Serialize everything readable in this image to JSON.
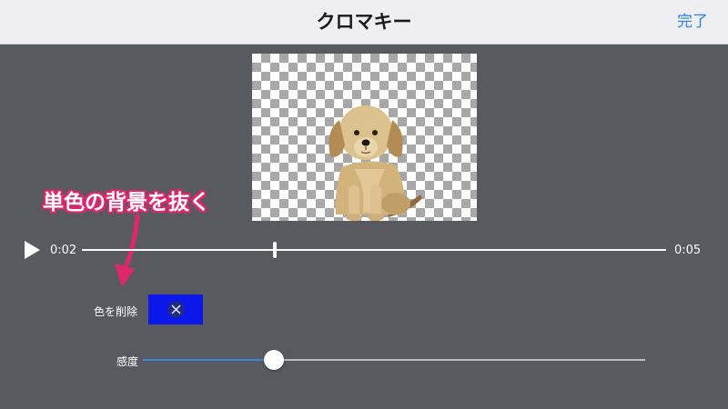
{
  "nav": {
    "title": "クロマキー",
    "done_label": "完了"
  },
  "preview": {
    "subject_icon": "dog-cutout-icon"
  },
  "annotation": {
    "callout_text": "単色の背景を抜く",
    "accent_color": "#e0266d"
  },
  "playback": {
    "current_time": "0:02",
    "total_time": "0:05",
    "progress": 0.33
  },
  "remove_color": {
    "label": "色を削除",
    "swatch_color": "#0c18ea"
  },
  "sensitivity": {
    "label": "感度",
    "value": 0.26
  }
}
